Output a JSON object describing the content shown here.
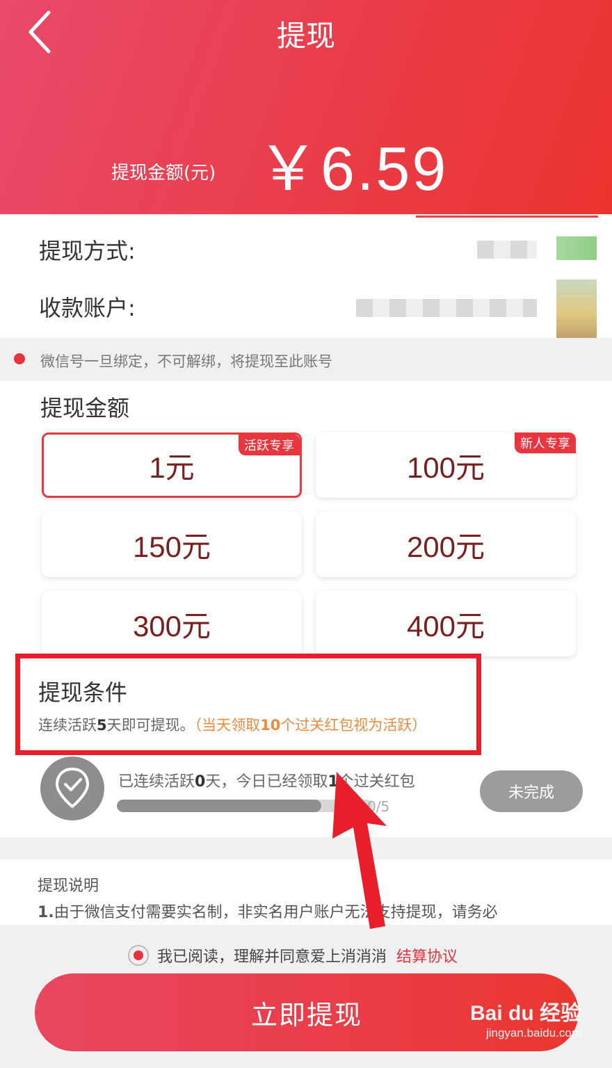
{
  "header": {
    "title": "提现",
    "amount_label": "提现金额(元)",
    "amount_value": "￥6.59"
  },
  "account": {
    "method_label": "提现方式:",
    "account_label": "收款账户:"
  },
  "notice": "微信号一旦绑定，不可解绑，将提现至此账号",
  "options": {
    "title": "提现金额",
    "items": [
      {
        "label": "1元",
        "tag": "活跃专享",
        "selected": true
      },
      {
        "label": "100元",
        "tag": "新人专享",
        "selected": false
      },
      {
        "label": "150元",
        "tag": "",
        "selected": false
      },
      {
        "label": "200元",
        "tag": "",
        "selected": false
      },
      {
        "label": "300元",
        "tag": "",
        "selected": false
      },
      {
        "label": "400元",
        "tag": "",
        "selected": false
      }
    ]
  },
  "conditions": {
    "title": "提现条件",
    "text_pre": "连续活跃",
    "text_days": "5",
    "text_post": "天即可提现。",
    "note_pre": "（当天领取",
    "note_count": "10",
    "note_post": "个过关红包视为活跃）"
  },
  "progress": {
    "text_a": "已连续活跃",
    "days": "0",
    "text_b": "天，今日已经领取",
    "collected": "1",
    "text_c": "个过关红包",
    "count": "0/5",
    "fraction": 0.8,
    "status": "未完成"
  },
  "explain": {
    "title": "提现说明",
    "line1_num": "1.",
    "line1": "由于微信支付需要实名制，非实名用户账户无法支持提现，请务必"
  },
  "agreement": {
    "text": "我已阅读，理解并同意爱上消消消",
    "link": "结算协议"
  },
  "submit_label": "立即提现",
  "watermark": {
    "brand": "Bai du 经验",
    "url": "jingyan.baidu.com"
  },
  "colors": {
    "accent": "#e9353d",
    "annotation": "#e81e2b",
    "note": "#ee8a3c"
  }
}
